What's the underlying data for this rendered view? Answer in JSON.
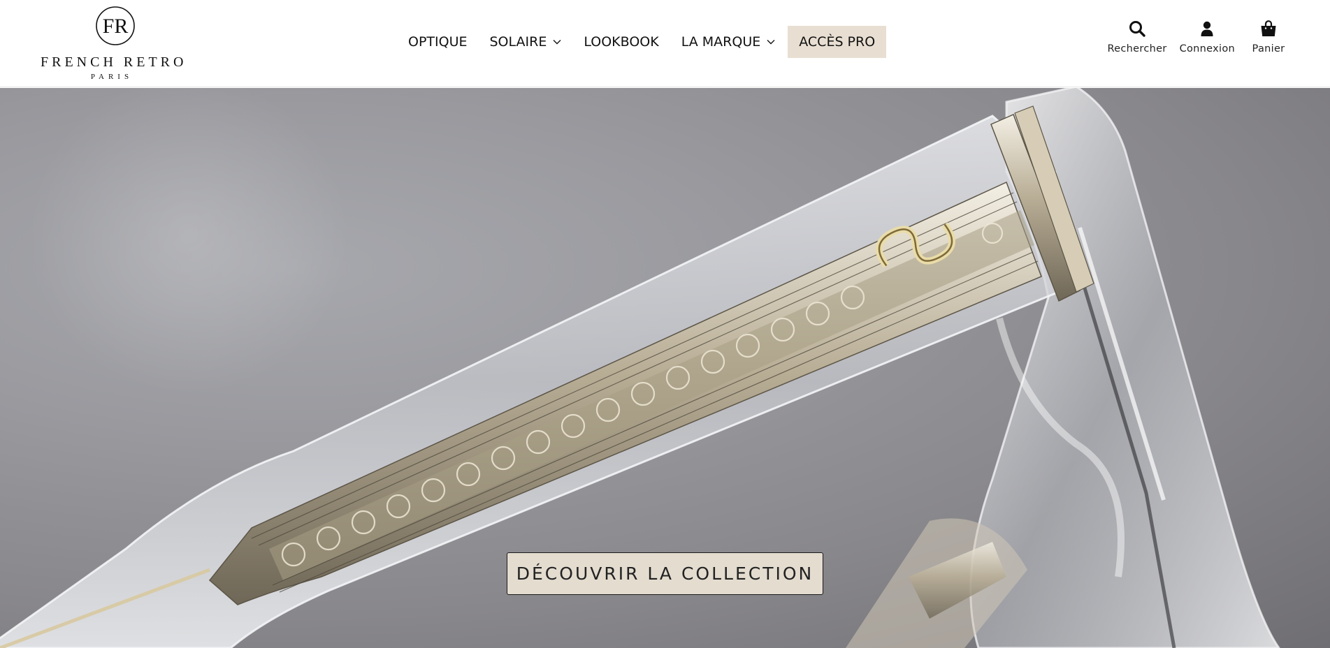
{
  "brand": {
    "monogram": "FR",
    "name": "FRENCH RETRO",
    "city": "PARIS"
  },
  "nav": {
    "items": [
      {
        "label": "OPTIQUE",
        "has_dropdown": false
      },
      {
        "label": "SOLAIRE",
        "has_dropdown": true
      },
      {
        "label": "LOOKBOOK",
        "has_dropdown": false
      },
      {
        "label": "LA MARQUE",
        "has_dropdown": true
      },
      {
        "label": "ACCÈS PRO",
        "has_dropdown": false,
        "highlighted": true
      }
    ]
  },
  "utilities": {
    "search": {
      "label": "Rechercher",
      "icon": "search-icon"
    },
    "account": {
      "label": "Connexion",
      "icon": "user-icon"
    },
    "cart": {
      "label": "Panier",
      "icon": "shopping-bag-icon"
    }
  },
  "hero": {
    "image": "eyeglasses-temple-closeup",
    "cta_label": "DÉCOUVRIR LA COLLECTION"
  },
  "colors": {
    "pro_highlight": "#e8dfd2",
    "cta_background": "#e3dccf",
    "hero_background": "#8f8e93",
    "text": "#111111"
  }
}
